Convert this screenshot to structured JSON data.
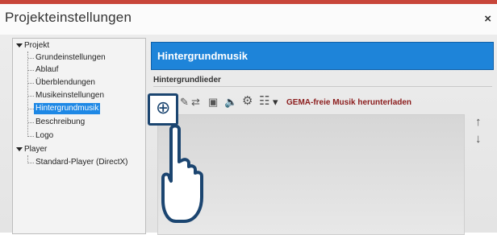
{
  "window": {
    "title": "Projekteinstellungen",
    "close": "×"
  },
  "tree": {
    "project": "Projekt",
    "items": [
      "Grundeinstellungen",
      "Ablauf",
      "Überblendungen",
      "Musikeinstellungen",
      "Hintergrundmusik",
      "Beschreibung",
      "Logo"
    ],
    "player": "Player",
    "player_items": [
      "Standard-Player (DirectX)"
    ]
  },
  "content": {
    "header": "Hintergrundmusik",
    "section": "Hintergrundlieder",
    "toolbar": {
      "add": "⊕",
      "edit": "✎",
      "swap": "⇄",
      "image": "▣",
      "speaker": "🔈",
      "settings": "⚙",
      "list": "☷",
      "dropdown": "▾",
      "link": "GEMA-freie Musik herunterladen"
    },
    "move_up": "↑",
    "move_down": "↓"
  },
  "colors": {
    "accent": "#1e84d9",
    "link": "#8b1c1c",
    "highlight": "#1b4570"
  }
}
